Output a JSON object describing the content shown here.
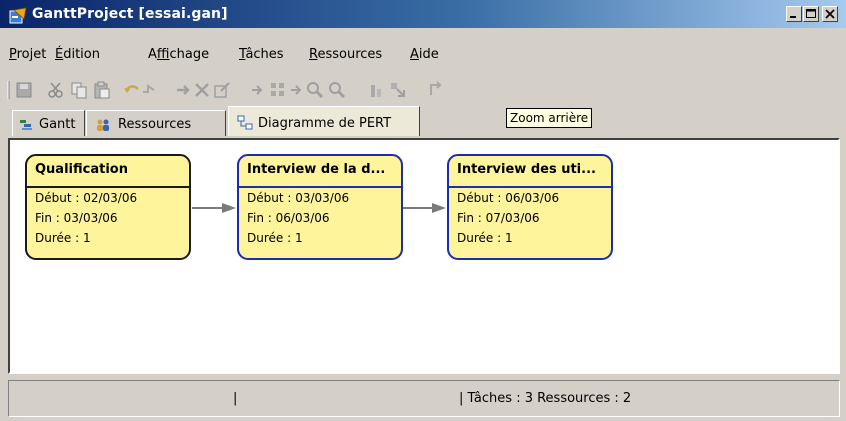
{
  "window": {
    "title": "GanttProject [essai.gan]",
    "controls": [
      "minimize",
      "maximize",
      "close"
    ]
  },
  "menu": [
    {
      "label": "Projet",
      "mnemonic": "P"
    },
    {
      "label": "Édition",
      "mnemonic": "É"
    },
    {
      "label": "Affichage",
      "mnemonic": "f"
    },
    {
      "label": "Tâches",
      "mnemonic": "T"
    },
    {
      "label": "Ressources",
      "mnemonic": "R"
    },
    {
      "label": "Aide",
      "mnemonic": "A"
    }
  ],
  "toolbar": {
    "icons": [
      "save-icon",
      "cut-icon",
      "copy-icon",
      "paste-icon",
      "undo-icon",
      "redo-icon",
      "indent-icon",
      "delete-icon",
      "properties-icon",
      "unlink-icon",
      "link-icon",
      "arrow-icon",
      "zoom-in-icon",
      "zoom-out-icon",
      "chart-icon",
      "assign-icon",
      "refresh-icon"
    ]
  },
  "tabs": [
    {
      "label": "Gantt",
      "icon": "gantt-icon",
      "active": false
    },
    {
      "label": "Ressources",
      "icon": "resources-icon",
      "active": false
    },
    {
      "label": "Diagramme de PERT",
      "icon": "pert-icon",
      "active": true
    }
  ],
  "tooltip": "Zoom arrière",
  "pert": {
    "nodes": [
      {
        "title": "Qualification",
        "debut": "Début : 02/03/06",
        "fin": "Fin : 03/03/06",
        "duree": "Durée : 1",
        "border": "#1a1a1a"
      },
      {
        "title": "Interview de la d...",
        "debut": "Début : 03/03/06",
        "fin": "Fin : 06/03/06",
        "duree": "Durée : 1",
        "border": "#1c2eb0"
      },
      {
        "title": "Interview des uti...",
        "debut": "Début : 06/03/06",
        "fin": "Fin : 07/03/06",
        "duree": "Durée : 1",
        "border": "#1c2eb0"
      }
    ],
    "node_fill": "#fef49c"
  },
  "status": {
    "left_separator": "|",
    "text": "| Tâches : 3  Ressources : 2"
  }
}
